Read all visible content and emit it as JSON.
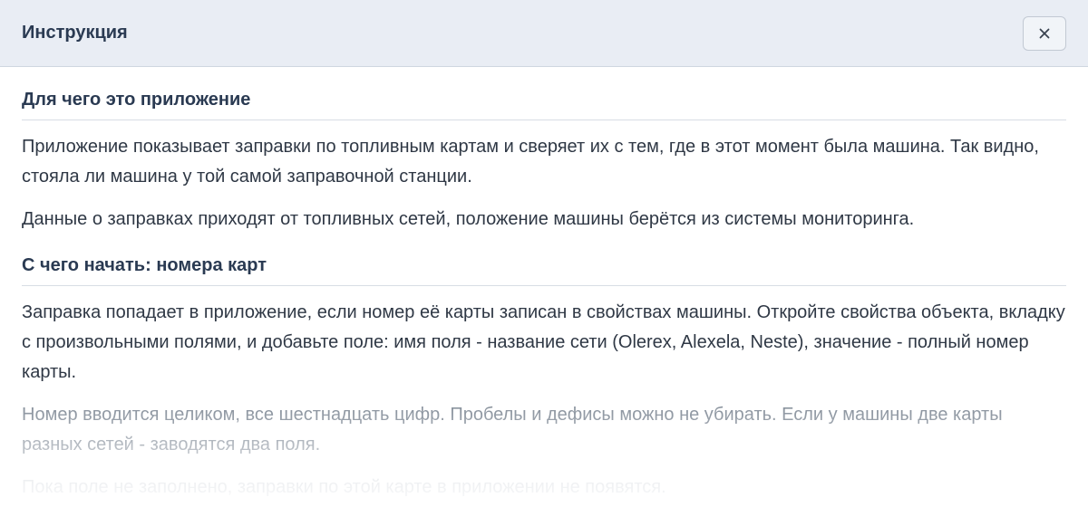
{
  "header": {
    "title": "Инструкция",
    "close_icon": "close-icon"
  },
  "sections": [
    {
      "title": "Для чего это приложение",
      "paragraphs": [
        "Приложение показывает заправки по топливным картам и сверяет их с тем, где в этот момент была машина. Так видно, стояла ли машина у той самой заправочной станции.",
        "Данные о заправках приходят от топливных сетей, положение машины берётся из системы мониторинга."
      ]
    },
    {
      "title": "С чего начать: номера карт",
      "paragraphs": [
        "Заправка попадает в приложение, если номер её карты записан в свойствах машины. Откройте свойства объекта, вкладку с произвольными полями, и добавьте поле: имя поля - название сети (Olerex, Alexela, Neste), значение - полный номер карты.",
        "Номер вводится целиком, все шестнадцать цифр. Пробелы и дефисы можно не убирать. Если у машины две карты разных сетей - заводятся два поля.",
        "Пока поле не заполнено, заправки по этой карте в приложении не появятся."
      ]
    }
  ]
}
